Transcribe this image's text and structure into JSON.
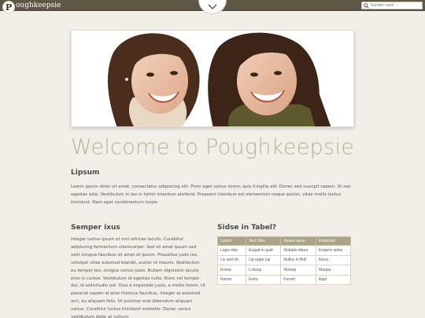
{
  "header": {
    "logo_letter": "P",
    "brand": "oughkeepsie",
    "search_placeholder": "Suchen nach ...",
    "colors": {
      "bar": "#5f5746",
      "accent": "#aaa385"
    }
  },
  "hero": {
    "image_alt": "Two smiling women looking at each other"
  },
  "main": {
    "title": "Welcome to Poughkeepsie",
    "lipsum_heading": "Lipsum",
    "lipsum_text": "Lorem ipsum dolor sit amet, consectetur adipiscing elit. Proin eget varius lorem, quis fringilla elit. Donec sed suscipit sapien. Ut nec egestas odio. Vestibulum in leo in tortor interdum eleifend. Praesent interdum est elementum neque auctor, vitae mollis lectus tincidunt. Nam eget condimentum turpis",
    "semper_heading": "Semper ixus",
    "semper_text": "Integer luctus ipsum et orci ultrices iaculis. Curabitur adipiscing fermentum ullamcorper. Sed sit amet ipsum sed velit congue faucibus sit amet at ipsum. Phasellus justo leo, volutpat vitae euismod blandit, auctor id mauris. Vestibulum eu tempor leo, congue varius justo. Nullam dignissim iaculis eros in cursus. Vestibulum id egestas nulla. Nunc vel tempor dui, id sollicitudin est. Duis a imperdiet justo, a mollis lorem. Ut placerat sapien id ante rhoncus faucibus. Integer at euismod orci, eu aliquam felis. Ut pulvinar erat bibendum aliquam varius. Curabitur luctus tincidunt molestie. Donec varius vestibulum dolor at rutrum.",
    "table_heading": "Sidse in Tabel?",
    "table": {
      "headers": [
        "Lorem",
        "Sed Ultre",
        "Neque egue",
        "Empirium"
      ],
      "rows": [
        [
          "Logis etta",
          "Euqad in quid",
          "Nobalis ettara",
          "Empirm sidse"
        ],
        [
          "Lic sed nic",
          "Lip eppe Lip",
          "Nullus in Bull",
          "Nuna"
        ],
        [
          "Errata",
          "Lolouip",
          "Nonoip",
          "Maqua"
        ],
        [
          "Numis",
          "Extra",
          "Furunt",
          "Eppr"
        ]
      ]
    }
  }
}
